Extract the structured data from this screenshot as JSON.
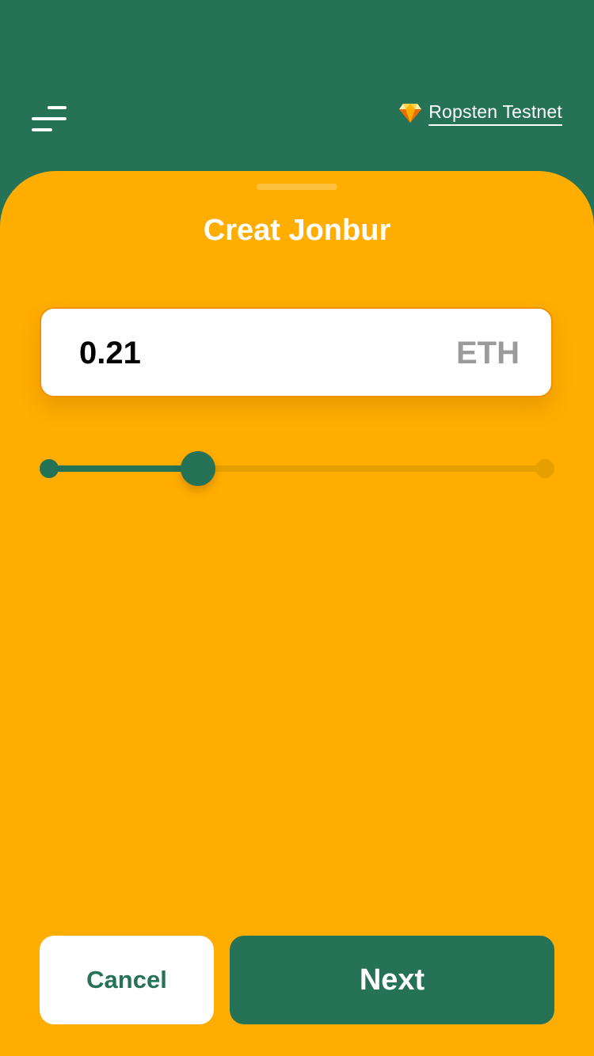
{
  "header": {
    "network_label": "Ropsten Testnet",
    "network_icon": "diamond-icon",
    "menu_icon": "menu-icon"
  },
  "sheet": {
    "title": "Creat Jonbur"
  },
  "amount": {
    "value": "0.21",
    "unit": "ETH"
  },
  "slider": {
    "fraction": 0.3
  },
  "actions": {
    "cancel_label": "Cancel",
    "next_label": "Next"
  },
  "colors": {
    "primary_green": "#257256",
    "accent_orange": "#FFAD00",
    "input_border": "#F29100",
    "unit_gray": "#9B9B9B"
  }
}
